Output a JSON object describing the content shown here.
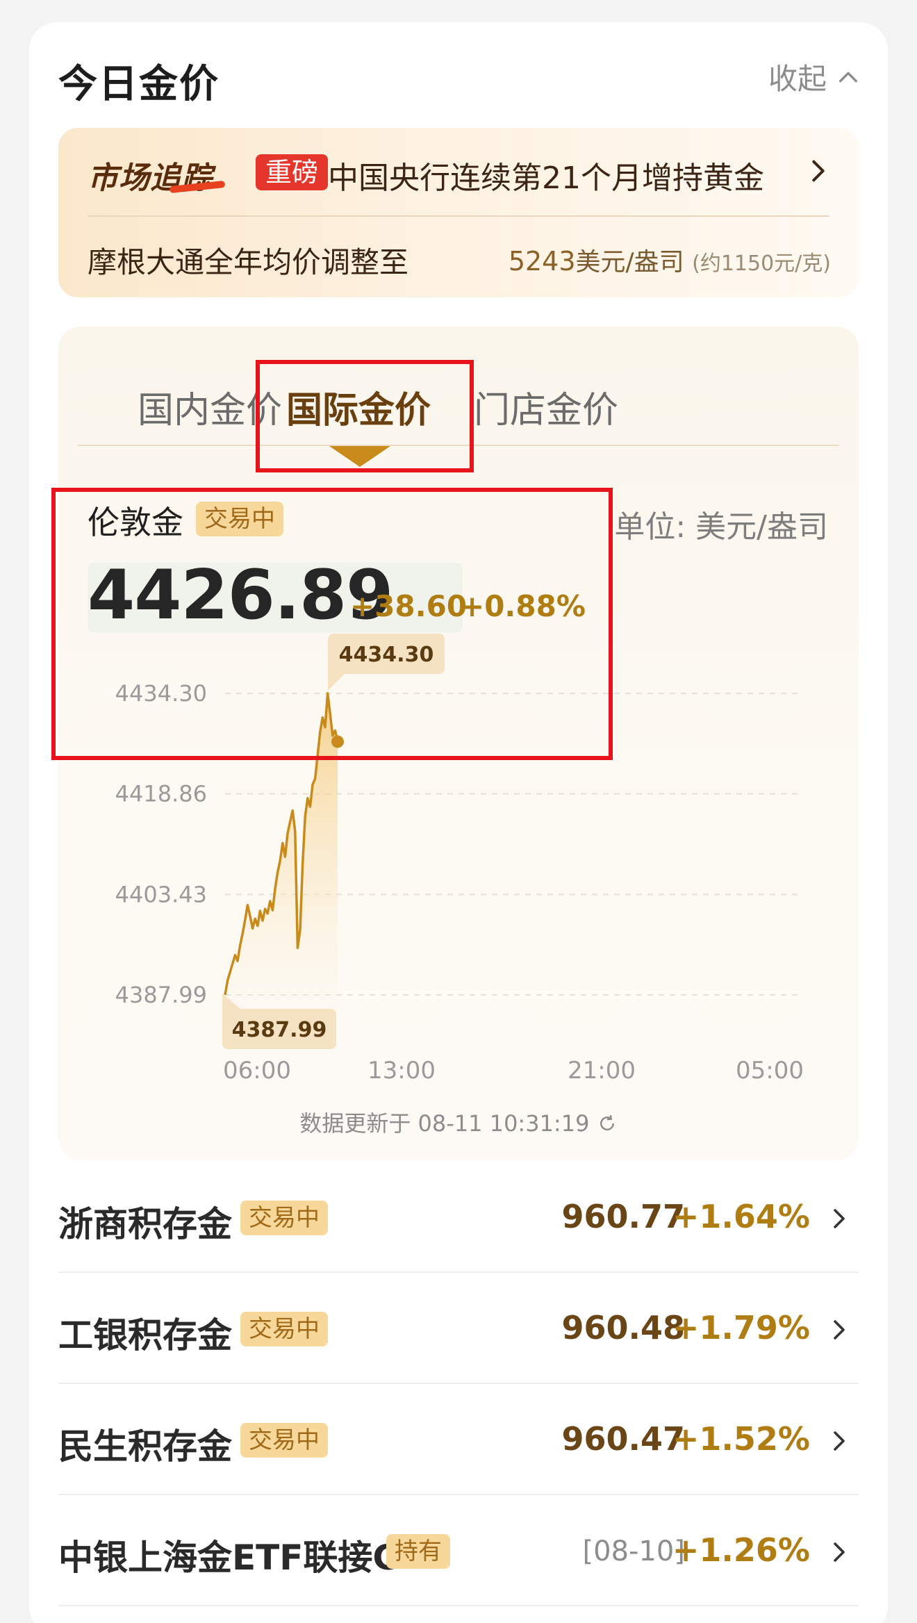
{
  "header": {
    "title": "今日金价",
    "collapse_label": "收起"
  },
  "news": {
    "brand": "市场追踪",
    "tag": "重磅",
    "headline": "中国央行连续第21个月增持黄金",
    "sub_text": "摩根大通全年均价调整至",
    "sub_value": "5243",
    "sub_unit": "美元/盎司",
    "sub_note": "(约1150元/克)"
  },
  "tabs": [
    {
      "label": "国内金价",
      "active": false
    },
    {
      "label": "国际金价",
      "active": true
    },
    {
      "label": "门店金价",
      "active": false
    }
  ],
  "quote": {
    "name": "伦敦金",
    "status": "交易中",
    "unit_label": "单位: 美元/盎司",
    "price": "4426.89",
    "change": "+38.60",
    "change_pct": "+0.88%"
  },
  "chart_data": {
    "type": "area",
    "title": "",
    "xlabel": "",
    "ylabel": "",
    "x_ticks": [
      "06:00",
      "13:00",
      "21:00",
      "05:00"
    ],
    "y_ticks": [
      "4434.30",
      "4418.86",
      "4403.43",
      "4387.99"
    ],
    "ylim": [
      4387.99,
      4434.3
    ],
    "high_label": "4434.30",
    "low_label": "4387.99",
    "series": [
      {
        "values": [
          4387.99,
          4390.2,
          4391.5,
          4392.8,
          4394.1,
          4393.2,
          4395.6,
          4397.4,
          4399.5,
          4401.8,
          4400.1,
          4398.2,
          4399.7,
          4398.6,
          4400.9,
          4399.4,
          4401.2,
          4400.5,
          4402.4,
          4401.0,
          4404.3,
          4406.8,
          4408.6,
          4411.3,
          4409.2,
          4412.8,
          4414.6,
          4416.3,
          4413.1,
          4395.2,
          4398.0,
          4408.0,
          4415.4,
          4418.2,
          4416.9,
          4420.3,
          4421.2,
          4424.8,
          4428.4,
          4430.6,
          4429.1,
          4434.3,
          4431.2,
          4427.8,
          4428.6,
          4426.89
        ]
      }
    ],
    "grid": true
  },
  "updated": "数据更新于 08-11 10:31:19",
  "products": [
    {
      "name": "浙商积存金",
      "badge": "交易中",
      "value": "960.77",
      "pct": "+1.64%"
    },
    {
      "name": "工银积存金",
      "badge": "交易中",
      "value": "960.48",
      "pct": "+1.79%"
    },
    {
      "name": "民生积存金",
      "badge": "交易中",
      "value": "960.47",
      "pct": "+1.52%"
    },
    {
      "name": "中银上海金ETF联接C",
      "badge": "持有",
      "value": "[08-10]",
      "pct": "+1.26%"
    }
  ],
  "colors": {
    "accent": "#c88a1a",
    "badge_bg": "#f7d89a",
    "tag_red": "#e5362c",
    "highlight_box": "#e8141b"
  }
}
